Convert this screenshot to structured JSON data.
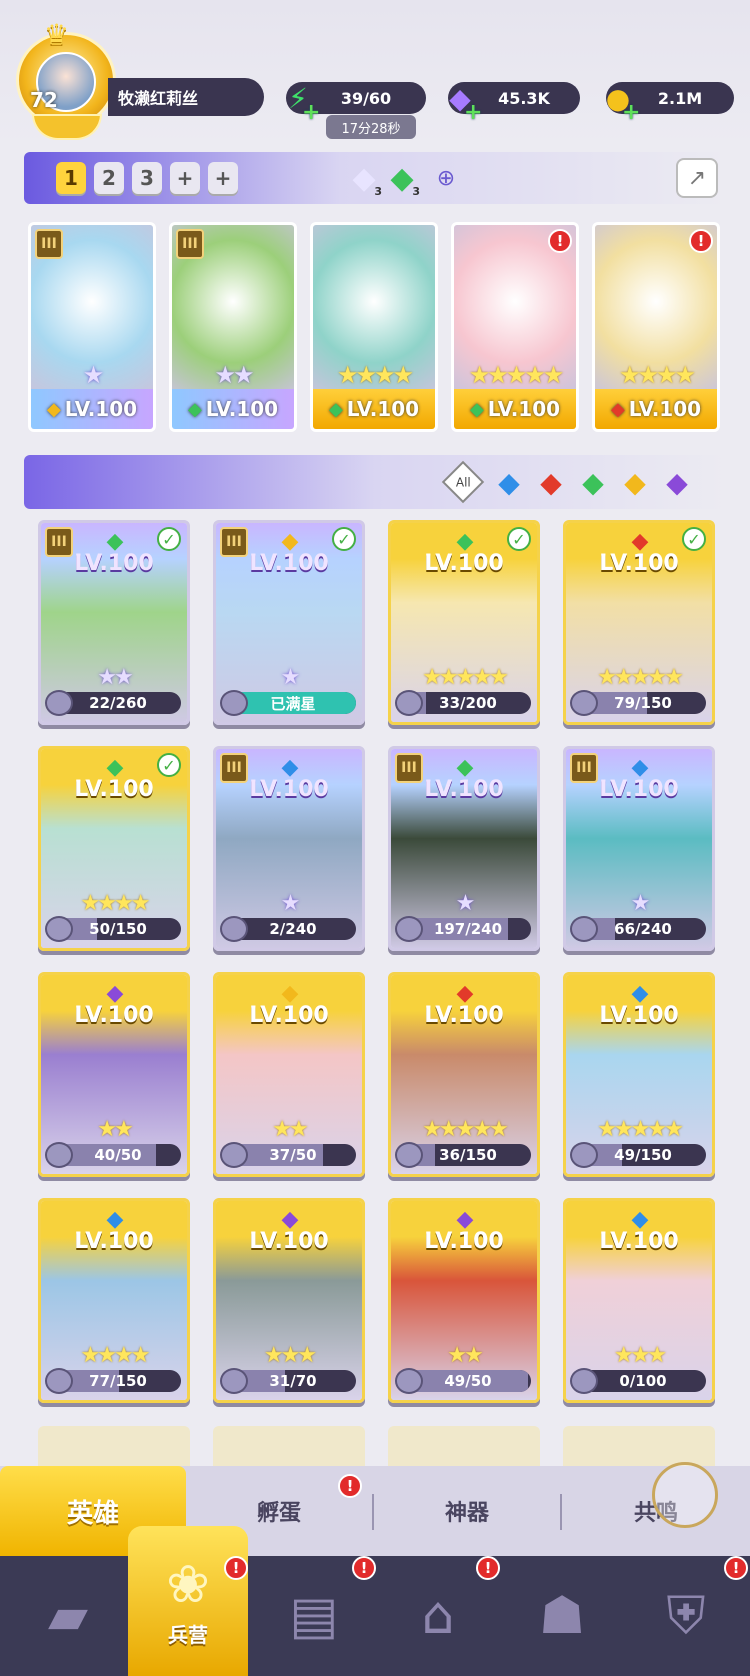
{
  "player": {
    "level": "72",
    "name": "牧濑红莉丝"
  },
  "resources": [
    {
      "name": "energy",
      "icon": "lightning-icon",
      "value": "39/60",
      "timer": "17分28秒"
    },
    {
      "name": "gems",
      "icon": "gem-icon",
      "value": "45.3K"
    },
    {
      "name": "coins",
      "icon": "coin-icon",
      "value": "2.1M"
    }
  ],
  "team_tabs": [
    "1",
    "2",
    "3",
    "+",
    "+"
  ],
  "team_gems": [
    {
      "icon": "white-gem-icon",
      "count": "3"
    },
    {
      "icon": "green-gem-icon",
      "count": "3"
    }
  ],
  "team": [
    {
      "level": "LV.100",
      "element": "light",
      "stars": "★",
      "star_type": "purple",
      "rank": "III",
      "alert": false,
      "color": "#a8d8f0"
    },
    {
      "level": "LV.100",
      "element": "nature",
      "stars": "★★",
      "star_type": "purple",
      "rank": "III",
      "alert": false,
      "color": "#9ccf7a"
    },
    {
      "level": "LV.100",
      "element": "nature",
      "stars": "★★★★",
      "star_type": "gold",
      "rank": "",
      "alert": false,
      "color": "#8fd3c9"
    },
    {
      "level": "LV.100",
      "element": "nature",
      "stars": "★★★★★",
      "star_type": "gold",
      "rank": "",
      "alert": true,
      "color": "#f7c6d0"
    },
    {
      "level": "LV.100",
      "element": "fire",
      "stars": "★★★★",
      "star_type": "gold",
      "rank": "",
      "alert": true,
      "color": "#f2dfa0"
    }
  ],
  "filters": [
    "All",
    "water",
    "fire",
    "nature",
    "light",
    "dark"
  ],
  "heroes": [
    {
      "level": "LV.100",
      "element": "nature",
      "stars": "★★",
      "star_type": "purple",
      "rank": "III",
      "check": true,
      "progress": "22/260",
      "fraction": 0.08,
      "style": "purple",
      "color": "#9fd48a"
    },
    {
      "level": "LV.100",
      "element": "light",
      "stars": "★",
      "star_type": "purple",
      "rank": "III",
      "check": true,
      "progress": "已满星",
      "fraction": 1.0,
      "style": "purple",
      "color": "#b9d8f2"
    },
    {
      "level": "LV.100",
      "element": "nature",
      "stars": "★★★★★",
      "star_type": "gold",
      "rank": "",
      "check": true,
      "progress": "33/200",
      "fraction": 0.17,
      "style": "gold",
      "color": "#f6e7b0"
    },
    {
      "level": "LV.100",
      "element": "fire",
      "stars": "★★★★★",
      "star_type": "gold",
      "rank": "",
      "check": true,
      "progress": "79/150",
      "fraction": 0.53,
      "style": "gold",
      "color": "#f2dfa5"
    },
    {
      "level": "LV.100",
      "element": "nature",
      "stars": "★★★★",
      "star_type": "gold",
      "rank": "",
      "check": true,
      "progress": "50/150",
      "fraction": 0.33,
      "style": "gold",
      "color": "#b8e0d2"
    },
    {
      "level": "LV.100",
      "element": "water",
      "stars": "★",
      "star_type": "purple",
      "rank": "III",
      "check": false,
      "progress": "2/240",
      "fraction": 0.01,
      "style": "purple",
      "color": "#8fa8c2"
    },
    {
      "level": "LV.100",
      "element": "nature",
      "stars": "★",
      "star_type": "purple",
      "rank": "III",
      "check": false,
      "progress": "197/240",
      "fraction": 0.82,
      "style": "purple",
      "color": "#3b4a3a"
    },
    {
      "level": "LV.100",
      "element": "water",
      "stars": "★",
      "star_type": "purple",
      "rank": "III",
      "check": false,
      "progress": "66/240",
      "fraction": 0.28,
      "style": "purple",
      "color": "#5bbcc2"
    },
    {
      "level": "LV.100",
      "element": "dark",
      "stars": "★★",
      "star_type": "gold",
      "rank": "",
      "check": false,
      "progress": "40/50",
      "fraction": 0.8,
      "style": "gold",
      "color": "#9a7fd0"
    },
    {
      "level": "LV.100",
      "element": "light",
      "stars": "★★",
      "star_type": "gold",
      "rank": "",
      "check": false,
      "progress": "37/50",
      "fraction": 0.74,
      "style": "gold",
      "color": "#f4c6c6"
    },
    {
      "level": "LV.100",
      "element": "fire",
      "stars": "★★★★★",
      "star_type": "gold",
      "rank": "",
      "check": false,
      "progress": "36/150",
      "fraction": 0.24,
      "style": "gold",
      "color": "#c98a6a"
    },
    {
      "level": "LV.100",
      "element": "water",
      "stars": "★★★★★",
      "star_type": "gold",
      "rank": "",
      "check": false,
      "progress": "49/150",
      "fraction": 0.33,
      "style": "gold",
      "color": "#a9d6ef"
    },
    {
      "level": "LV.100",
      "element": "water",
      "stars": "★★★★",
      "star_type": "gold",
      "rank": "",
      "check": false,
      "progress": "77/150",
      "fraction": 0.51,
      "style": "gold",
      "color": "#9cc6e6"
    },
    {
      "level": "LV.100",
      "element": "dark",
      "stars": "★★★",
      "star_type": "gold",
      "rank": "",
      "check": false,
      "progress": "31/70",
      "fraction": 0.44,
      "style": "gold",
      "color": "#8a9a98"
    },
    {
      "level": "LV.100",
      "element": "dark",
      "stars": "★★",
      "star_type": "gold",
      "rank": "",
      "check": false,
      "progress": "49/50",
      "fraction": 0.98,
      "style": "gold",
      "color": "#d9553a"
    },
    {
      "level": "LV.100",
      "element": "water",
      "stars": "★★★",
      "star_type": "gold",
      "rank": "",
      "check": false,
      "progress": "0/100",
      "fraction": 0.0,
      "style": "gold",
      "color": "#f0d0d8"
    }
  ],
  "tabs": [
    {
      "label": "英雄",
      "active": true,
      "alert": false
    },
    {
      "label": "孵蛋",
      "active": false,
      "alert": true
    },
    {
      "label": "神器",
      "active": false,
      "alert": false
    },
    {
      "label": "共鸣",
      "active": false,
      "alert": false
    }
  ],
  "nav": [
    {
      "icon": "cards-icon",
      "label": "",
      "active": false,
      "alert": false
    },
    {
      "icon": "barracks-icon",
      "label": "兵营",
      "active": true,
      "alert": true
    },
    {
      "icon": "book-icon",
      "label": "",
      "active": false,
      "alert": true
    },
    {
      "icon": "castle-icon",
      "label": "",
      "active": false,
      "alert": true
    },
    {
      "icon": "mushroom-icon",
      "label": "",
      "active": false,
      "alert": false
    },
    {
      "icon": "shield-icon",
      "label": "",
      "active": false,
      "alert": true
    }
  ],
  "colors": {
    "nature": "#3cc25a",
    "water": "#2f8ee8",
    "fire": "#e23a2a",
    "light": "#f2b81c",
    "dark": "#8a4ad8",
    "gold": "#f5c930",
    "purple": "#9b7be8"
  }
}
